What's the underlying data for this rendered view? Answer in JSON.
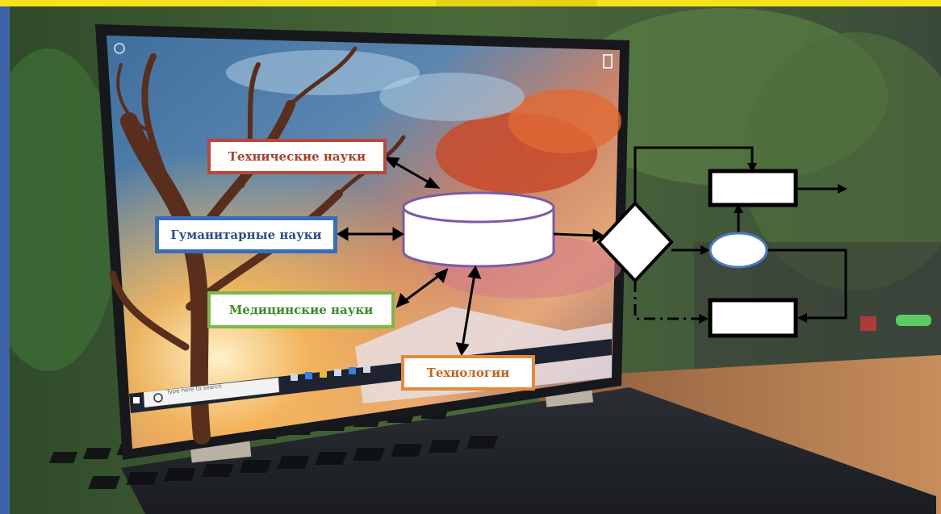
{
  "diagram": {
    "labels": {
      "technical_sciences": "Технические науки",
      "humanities": "Гуманитарные науки",
      "medical_sciences": "Медицинские науки",
      "technologies": "Технологии"
    }
  },
  "laptop": {
    "taskbar": {
      "search_placeholder": "Type here to search"
    },
    "brand_icon": "n-logo-icon"
  },
  "colors": {
    "top_bar": "#f5e21a",
    "cylinder_stroke": "#7b5ba8",
    "technical_border": "#b8483a",
    "humanities_border": "#3a6db5",
    "medical_border": "#7bb84a",
    "technologies_border": "#e58a3a",
    "ellipse_stroke": "#4a78c4"
  }
}
